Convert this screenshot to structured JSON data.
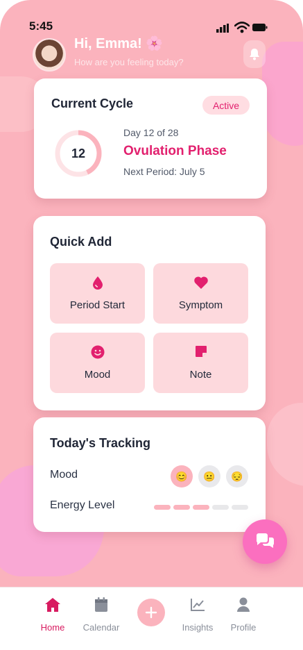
{
  "status_bar": {
    "time": "5:45"
  },
  "header": {
    "greeting": "Hi, Emma! 🌸",
    "subtitle": "How are you feeling today?"
  },
  "current_cycle": {
    "title": "Current Cycle",
    "badge": "Active",
    "day_number": "12",
    "day_text": "Day 12 of 28",
    "phase": "Ovulation Phase",
    "next_period": "Next Period: July 5",
    "progress": 0.43
  },
  "quick_add": {
    "title": "Quick Add",
    "items": [
      {
        "label": "Period Start",
        "icon": "drop-icon"
      },
      {
        "label": "Symptom",
        "icon": "heart-icon"
      },
      {
        "label": "Mood",
        "icon": "smile-icon"
      },
      {
        "label": "Note",
        "icon": "note-icon"
      }
    ]
  },
  "tracking": {
    "title": "Today's Tracking",
    "mood_label": "Mood",
    "moods": [
      "😊",
      "😐",
      "😔"
    ],
    "selected_mood": 0,
    "energy_label": "Energy Level",
    "energy_level": 3,
    "energy_max": 5
  },
  "nav": {
    "items": [
      {
        "label": "Home",
        "icon": "home-icon",
        "active": true
      },
      {
        "label": "Calendar",
        "icon": "calendar-icon",
        "active": false
      },
      {
        "label": "Insights",
        "icon": "chart-icon",
        "active": false
      },
      {
        "label": "Profile",
        "icon": "user-icon",
        "active": false
      }
    ]
  },
  "colors": {
    "accent": "#e2206e",
    "background": "#fbb3bd",
    "tile": "#fdd9dd",
    "fab": "#fb6fbf"
  }
}
